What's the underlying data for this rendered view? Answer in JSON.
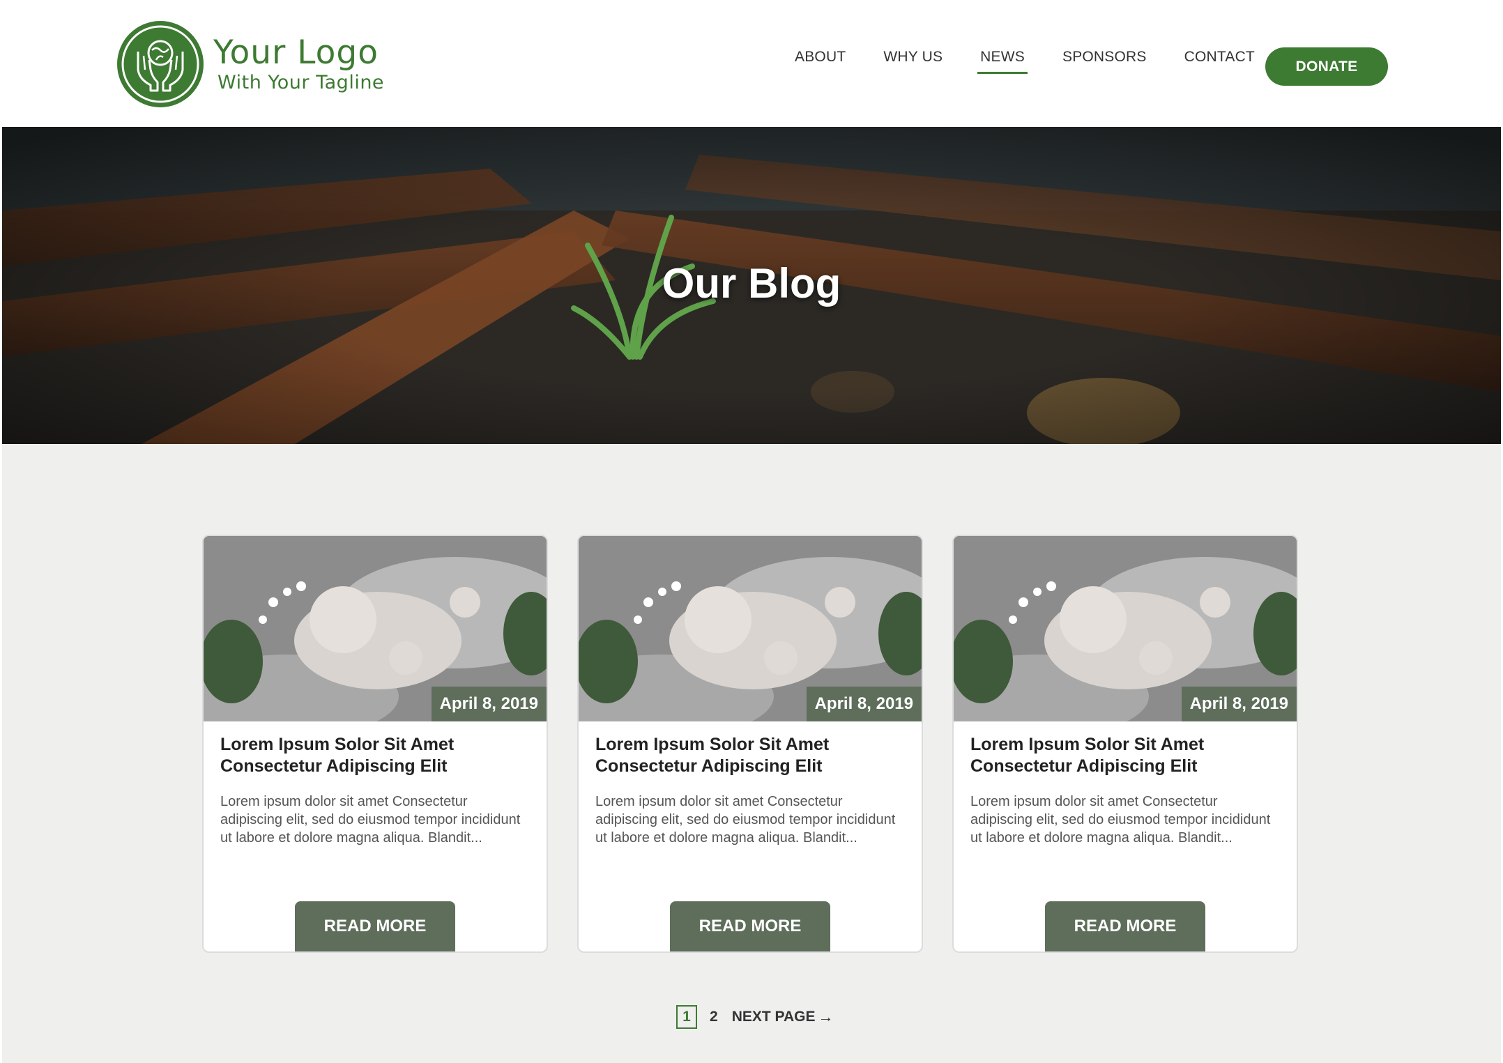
{
  "logo": {
    "title": "Your Logo",
    "tagline": "With Your Tagline",
    "icon": "hands-globe-icon",
    "color": "#3d7a32"
  },
  "nav": {
    "items": [
      {
        "label": "ABOUT",
        "active": false
      },
      {
        "label": "WHY US",
        "active": false
      },
      {
        "label": "NEWS",
        "active": true
      },
      {
        "label": "SPONSORS",
        "active": false
      },
      {
        "label": "CONTACT",
        "active": false
      }
    ],
    "donate_label": "DONATE"
  },
  "hero": {
    "title": "Our Blog"
  },
  "posts": [
    {
      "date": "April 8, 2019",
      "title": "Lorem Ipsum Solor Sit Amet Consectetur Adipiscing Elit",
      "excerpt": "Lorem ipsum dolor sit amet Consectetur adipiscing elit, sed do eiusmod tempor incididunt ut labore et dolore magna aliqua. Blandit...",
      "button": "READ MORE"
    },
    {
      "date": "April 8, 2019",
      "title": "Lorem Ipsum Solor Sit Amet Consectetur Adipiscing Elit",
      "excerpt": "Lorem ipsum dolor sit amet Consectetur adipiscing elit, sed do eiusmod tempor incididunt ut labore et dolore magna aliqua. Blandit...",
      "button": "READ MORE"
    },
    {
      "date": "April 8, 2019",
      "title": "Lorem Ipsum Solor Sit Amet Consectetur Adipiscing Elit",
      "excerpt": "Lorem ipsum dolor sit amet Consectetur adipiscing elit, sed do eiusmod tempor incididunt ut labore et dolore magna aliqua. Blandit...",
      "button": "READ MORE"
    }
  ],
  "pagination": {
    "current": "1",
    "next_number": "2",
    "next_label": "NEXT PAGE",
    "arrow": "→"
  },
  "colors": {
    "brand_green": "#3d7a32",
    "card_accent": "#5e6e5b",
    "content_bg": "#efefee"
  }
}
